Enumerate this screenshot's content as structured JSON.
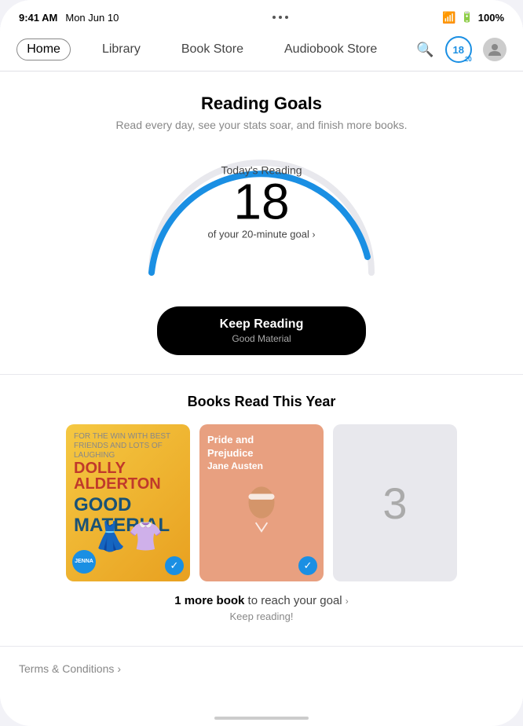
{
  "status": {
    "time": "9:41 AM",
    "date": "Mon Jun 10",
    "wifi": "▲",
    "battery_pct": "100%"
  },
  "nav": {
    "items": [
      {
        "label": "Home",
        "active": true
      },
      {
        "label": "Library",
        "active": false
      },
      {
        "label": "Book Store",
        "active": false
      },
      {
        "label": "Audiobook Store",
        "active": false
      }
    ],
    "badge_number": "18",
    "badge_sub": "20"
  },
  "reading_goals": {
    "title": "Reading Goals",
    "subtitle": "Read every day, see your stats soar, and finish more books.",
    "todays_reading_label": "Today's Reading",
    "minutes": "18",
    "goal_text": "of your 20-minute goal",
    "keep_reading_label": "Keep Reading",
    "keep_reading_book": "Good Material",
    "gauge_percent": 90
  },
  "books_section": {
    "title": "Books Read This Year",
    "books": [
      {
        "id": "good-material",
        "author_line1": "DOLLY",
        "author_line2": "ALDERTON",
        "title_line1": "GOOD",
        "title_line2": "MATERIAL",
        "badge_text": "JENNA",
        "has_check": true
      },
      {
        "id": "pride-prejudice",
        "title": "Pride and\nPrejudice",
        "author": "Jane Austen",
        "has_check": true
      },
      {
        "id": "placeholder",
        "number": "3",
        "has_check": false
      }
    ],
    "goal_message_part1": "1 more book",
    "goal_message_part2": " to reach your goal",
    "keep_reading_hint": "Keep reading!"
  },
  "footer": {
    "terms_label": "Terms & Conditions",
    "chevron": "›"
  }
}
